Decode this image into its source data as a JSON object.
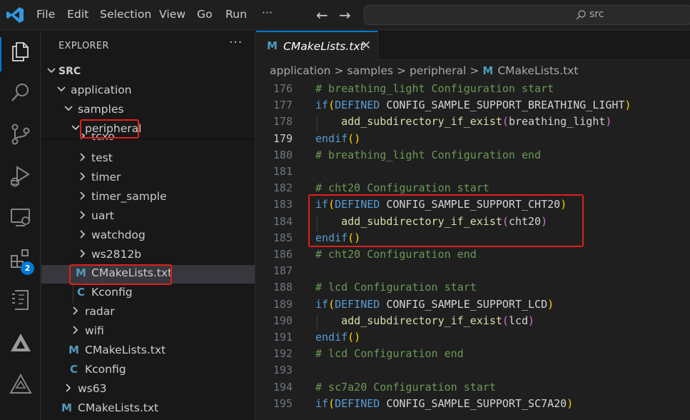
{
  "titlebar": {
    "menu": [
      "File",
      "Edit",
      "Selection",
      "View",
      "Go",
      "Run"
    ],
    "more": "···",
    "command_center_text": "src"
  },
  "activitybar": {
    "icons": [
      "explorer-icon",
      "search-icon",
      "source-control-icon",
      "run-debug-icon",
      "remote-explorer-icon",
      "extensions-icon",
      "device-manager-icon",
      "triangle-tool-icon",
      "triangle-build-icon"
    ],
    "extensions_badge": "2"
  },
  "sidebar": {
    "title": "EXPLORER",
    "more": "···",
    "root": "SRC",
    "tree": {
      "application": "application",
      "samples": "samples",
      "peripheral": "peripheral",
      "tcxo": "tcxo",
      "test": "test",
      "timer": "timer",
      "timer_sample": "timer_sample",
      "uart": "uart",
      "watchdog": "watchdog",
      "ws2812b": "ws2812b",
      "cmakelists_peripheral": "CMakeLists.txt",
      "kconfig_peripheral": "Kconfig",
      "radar": "radar",
      "wifi": "wifi",
      "cmakelists_samples": "CMakeLists.txt",
      "kconfig_samples": "Kconfig",
      "ws63": "ws63",
      "cmakelists_application": "CMakeLists.txt"
    },
    "file_icon_m": "M",
    "file_icon_c": "C"
  },
  "editor": {
    "tab": {
      "icon": "M",
      "label": "CMakeLists.txt",
      "close": "✕"
    },
    "breadcrumb": [
      "application",
      "samples",
      "peripheral",
      "CMakeLists.txt"
    ],
    "breadcrumb_sep": ">",
    "lines": [
      {
        "n": "176",
        "comment": "# breathing_light Configuration start"
      },
      {
        "n": "177",
        "kw": "if",
        "p_open": "(",
        "kw2": "DEFINED",
        "id": " CONFIG_SAMPLE_SUPPORT_BREATHING_LIGHT",
        "p_close": ")"
      },
      {
        "n": "178",
        "indent": "    ",
        "fn": "add_subdirectory_if_exist",
        "p_open": "(",
        "arg": "breathing_light",
        "p_close": ")"
      },
      {
        "n": "179",
        "kw": "endif",
        "p_open": "(",
        "p_close": ")"
      },
      {
        "n": "180",
        "comment": "# breathing_light Configuration end"
      },
      {
        "n": "181"
      },
      {
        "n": "182",
        "comment": "# cht20 Configuration start"
      },
      {
        "n": "183",
        "kw": "if",
        "p_open": "(",
        "kw2": "DEFINED",
        "id": " CONFIG_SAMPLE_SUPPORT_CHT20",
        "p_close": ")"
      },
      {
        "n": "184",
        "indent": "    ",
        "fn": "add_subdirectory_if_exist",
        "p_open": "(",
        "arg": "cht20",
        "p_close": ")"
      },
      {
        "n": "185",
        "kw": "endif",
        "p_open": "(",
        "p_close": ")"
      },
      {
        "n": "186",
        "comment": "# cht20 Configuration end"
      },
      {
        "n": "187"
      },
      {
        "n": "188",
        "comment": "# lcd Configuration start"
      },
      {
        "n": "189",
        "kw": "if",
        "p_open": "(",
        "kw2": "DEFINED",
        "id": " CONFIG_SAMPLE_SUPPORT_LCD",
        "p_close": ")"
      },
      {
        "n": "190",
        "indent": "    ",
        "fn": "add_subdirectory_if_exist",
        "p_open": "(",
        "arg": "lcd",
        "p_close": ")"
      },
      {
        "n": "191",
        "kw": "endif",
        "p_open": "(",
        "p_close": ")"
      },
      {
        "n": "192",
        "comment": "# lcd Configuration end"
      },
      {
        "n": "193"
      },
      {
        "n": "194",
        "comment": "# sc7a20 Configuration start"
      },
      {
        "n": "195",
        "kw": "if",
        "p_open": "(",
        "kw2": "DEFINED",
        "id": " CONFIG_SAMPLE_SUPPORT_SC7A20",
        "p_close": ")"
      }
    ],
    "current_line": "179"
  },
  "colors": {
    "accent": "#0078d4",
    "highlight_box": "#e0201b",
    "comment": "#6a9955",
    "keyword": "#569cd6",
    "function": "#dcdcaa"
  }
}
